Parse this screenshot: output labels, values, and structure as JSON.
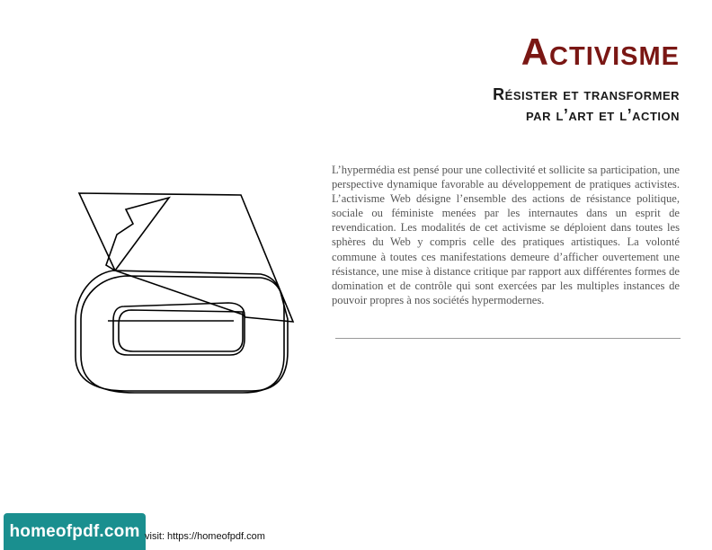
{
  "header": {
    "title": "Activisme",
    "subtitle_line1": "Résister et transformer",
    "subtitle_line2": "par l’art et l’action"
  },
  "body": {
    "paragraph": "L’hypermédia est pensé pour une collectivité et sollicite sa participation, une perspective dynamique favorable au développement de pratiques activistes. L’activisme Web désigne l’ensemble des actions de résistance politique, sociale ou féministe menées par les internautes dans un esprit de revendication. Les modalités de cet activisme se déploient dans toutes les sphères du Web y compris celle des pratiques artistiques. La volonté commune à toutes ces manifestations demeure d’afficher ouvertement une résistance, une mise à distance critique par rapport aux différentes formes de domination et de contrôle qui sont exercées par les multiples instances de pouvoir propres à nos sociétés hypermodernes."
  },
  "footer": {
    "badge_label": "homeofpdf.com",
    "visit_text": "visit: https://homeofpdf.com"
  },
  "colors": {
    "title": "#7a1714",
    "badge": "#1a8f8f",
    "body_text": "#555555"
  },
  "icons": {
    "logo_art": "outlined-a-glyph-illustration"
  }
}
